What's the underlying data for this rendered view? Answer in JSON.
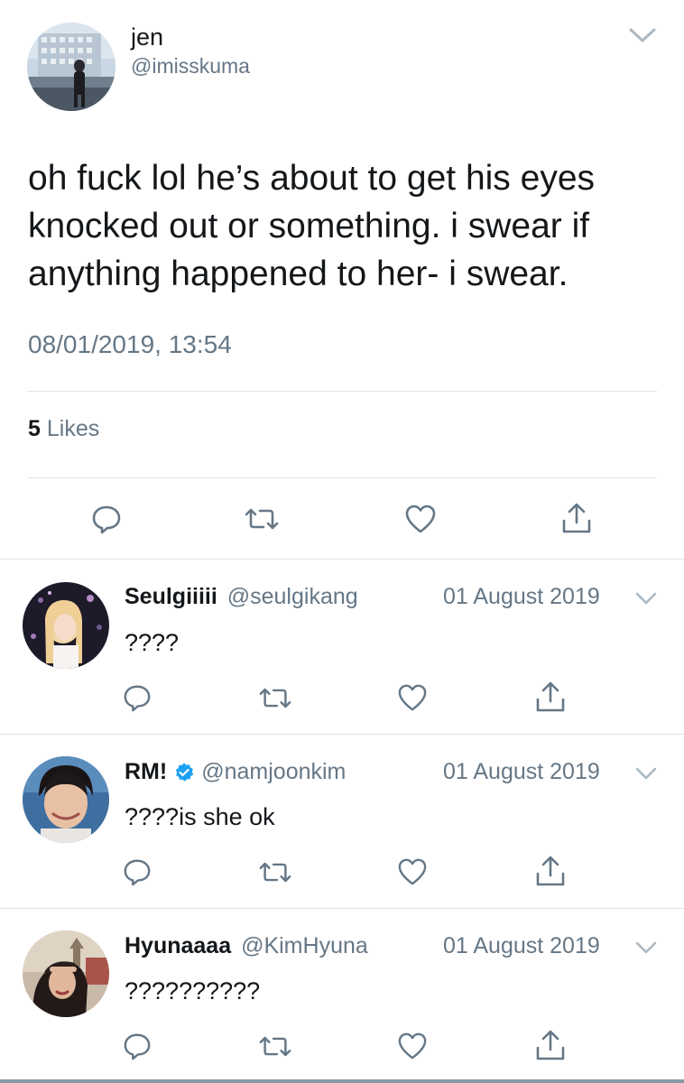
{
  "tweet": {
    "name": "jen",
    "handle": "@imisskuma",
    "text_line1": "oh fuck lol he’s about to get his eyes",
    "text_line2": "knocked out or something. i swear if",
    "text_line3": "anything happened to her- i swear.",
    "timestamp": "08/01/2019, 13:54",
    "likes_count": "5",
    "likes_label": "Likes"
  },
  "replies": [
    {
      "name": "Seulgiiiii",
      "handle": "@seulgikang",
      "date": "01 August 2019",
      "text": "????",
      "verified": false
    },
    {
      "name": "RM!",
      "handle": "@namjoonkim",
      "date": "01 August 2019",
      "text": "????is she ok",
      "verified": true
    },
    {
      "name": "Hyunaaaa",
      "handle": "@KimHyuna",
      "date": "01 August 2019",
      "text": "??????????",
      "verified": false
    }
  ],
  "icons": {
    "reply": "reply-icon",
    "retweet": "retweet-icon",
    "like": "heart-icon",
    "share": "share-icon",
    "menu": "chevron-down-icon",
    "verified": "verified-badge-icon"
  },
  "colors": {
    "text": "#14171a",
    "secondary": "#657786",
    "divider": "#dfe3e6",
    "verified": "#1da1f2"
  }
}
